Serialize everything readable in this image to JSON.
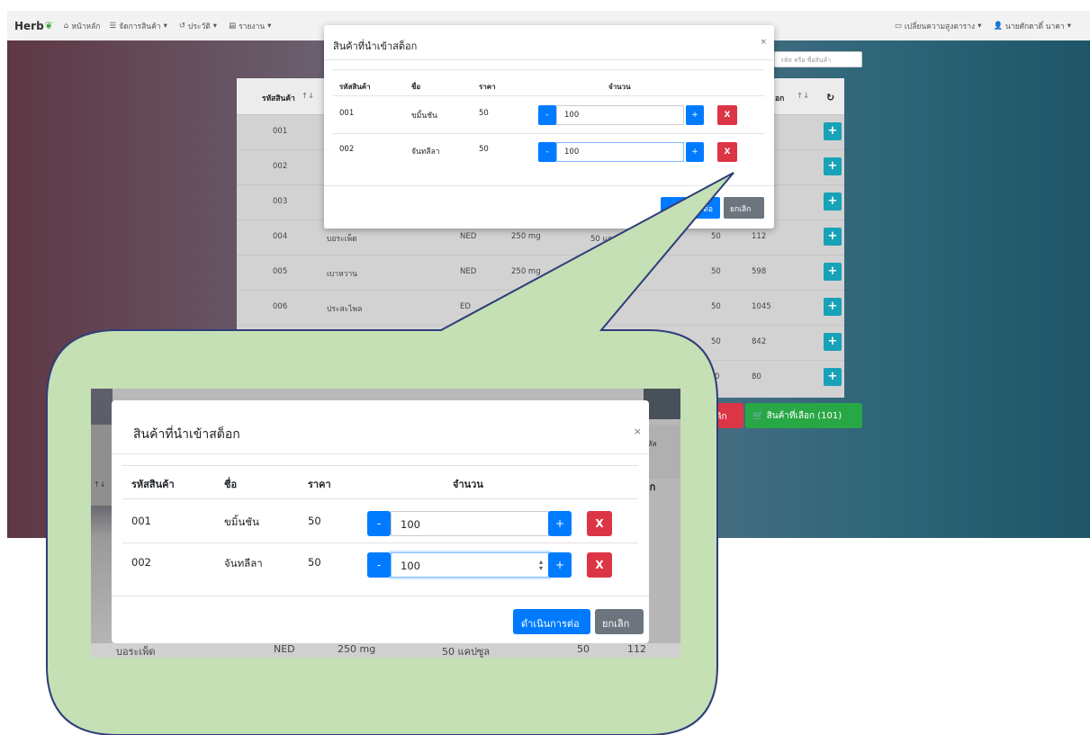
{
  "navbar": {
    "brand": "Herb",
    "home": "หน้าหลัก",
    "manage_products": "จัดการสินค้า",
    "history": "ประวัติ",
    "report": "รายงาน",
    "row_height": "เปลี่ยนความสูงตาราง",
    "user": "นายศักดาดิ์ นาคา"
  },
  "search": {
    "placeholder": "รหัส หรือ ชื่อสินค้า"
  },
  "background_table": {
    "col_code": "รหัสสินค้า",
    "col_stock": "อก",
    "rows": [
      {
        "code": "001",
        "name": "",
        "type": "",
        "dose": "",
        "pack": "",
        "price": "",
        "stock": ""
      },
      {
        "code": "002",
        "name": "",
        "type": "",
        "dose": "",
        "pack": "",
        "price": "",
        "stock": ""
      },
      {
        "code": "003",
        "name": "",
        "type": "",
        "dose": "",
        "pack": "",
        "price": "",
        "stock": ""
      },
      {
        "code": "004",
        "name": "บอระเพ็ด",
        "type": "NED",
        "dose": "250 mg",
        "pack": "50 แค",
        "price": "50",
        "stock": "112"
      },
      {
        "code": "005",
        "name": "เบาหวาน",
        "type": "NED",
        "dose": "250 mg",
        "pack": "",
        "price": "50",
        "stock": "598"
      },
      {
        "code": "006",
        "name": "ประสะไพล",
        "type": "ED",
        "dose": "",
        "pack": "",
        "price": "50",
        "stock": "1045"
      },
      {
        "code": "",
        "name": "",
        "type": "",
        "dose": "",
        "pack": "",
        "price": "50",
        "stock": "842"
      },
      {
        "code": "",
        "name": "",
        "type": "",
        "dose": "",
        "pack": "",
        "price": "0",
        "stock": "80"
      }
    ],
    "cancel_partial": "เลิก",
    "selected_button": "สินค้าที่เลือก (101)"
  },
  "modal": {
    "title": "สินค้าที่นำเข้าสต็อก",
    "headers": {
      "code": "รหัสสินค้า",
      "name": "ชื่อ",
      "price": "ราคา",
      "qty": "จำนวน"
    },
    "items": [
      {
        "code": "001",
        "name": "ขมิ้นชัน",
        "price": "50",
        "qty": "100"
      },
      {
        "code": "002",
        "name": "จันทลีลา",
        "price": "50",
        "qty": "100"
      }
    ],
    "minus_label": "-",
    "plus_label": "+",
    "remove_label": "X",
    "proceed_label": "ดำเนินการต่อ",
    "cancel_label": "ยกเลิก",
    "close_label": "×"
  },
  "zoom_background": {
    "right_fragment_1": "รหัส",
    "right_fragment_2": "อก",
    "bottom_row": {
      "name": "บอระเพ็ด",
      "type": "NED",
      "dose": "250 mg",
      "pack": "50 แคปซูล",
      "price": "50",
      "stock": "112"
    }
  },
  "colors": {
    "primary": "#007bff",
    "danger": "#dc3545",
    "secondary": "#6c757d",
    "info": "#17a2b8",
    "success": "#28a745",
    "callout_fill": "#c5e0b4",
    "callout_stroke": "#2f3d7a"
  }
}
